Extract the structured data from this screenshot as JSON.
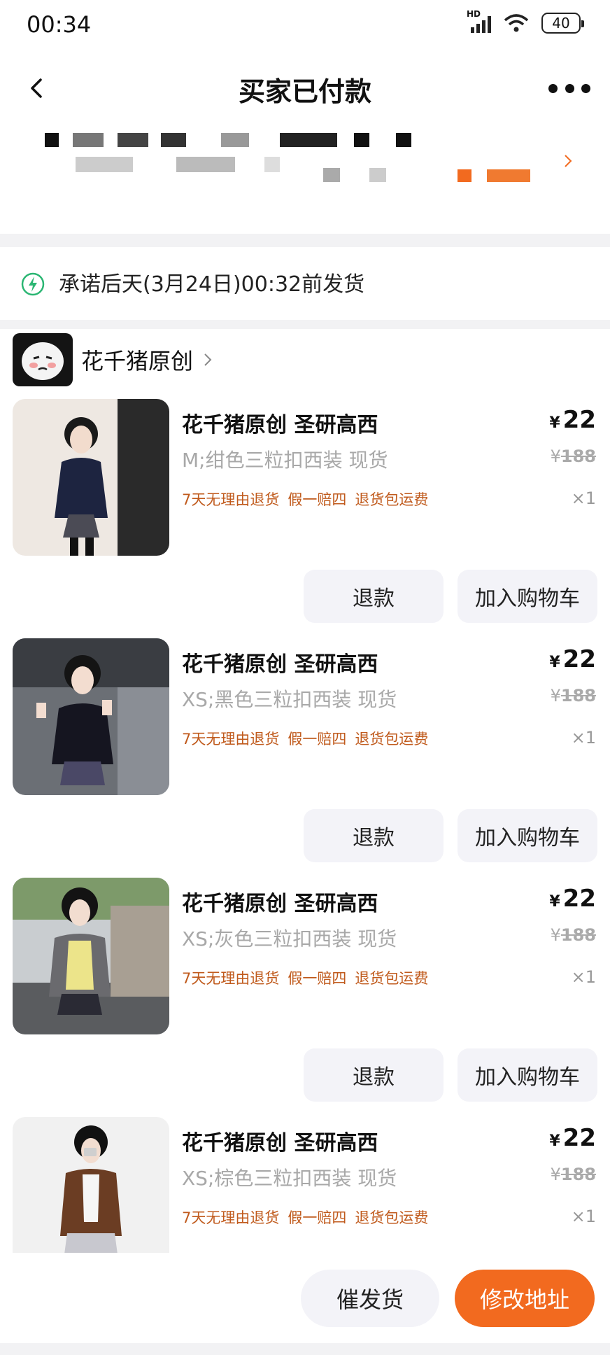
{
  "status_bar": {
    "time": "00:34",
    "network": "HD",
    "battery": "40"
  },
  "nav": {
    "title": "买家已付款"
  },
  "promise": {
    "text": "承诺后天(3月24日)00:32前发货"
  },
  "shop": {
    "name": "花千猪原创"
  },
  "items": [
    {
      "title": "花千猪原创 圣研高西",
      "sku": "M;绀色三粒扣西装 现货",
      "price_symbol": "¥",
      "price": "22",
      "original_price": "188",
      "quantity": "×1",
      "tags": [
        "7天无理由退货",
        "假一赔四",
        "退货包运费"
      ],
      "refund_label": "退款",
      "cart_label": "加入购物车"
    },
    {
      "title": "花千猪原创 圣研高西",
      "sku": "XS;黑色三粒扣西装 现货",
      "price_symbol": "¥",
      "price": "22",
      "original_price": "188",
      "quantity": "×1",
      "tags": [
        "7天无理由退货",
        "假一赔四",
        "退货包运费"
      ],
      "refund_label": "退款",
      "cart_label": "加入购物车"
    },
    {
      "title": "花千猪原创 圣研高西",
      "sku": "XS;灰色三粒扣西装 现货",
      "price_symbol": "¥",
      "price": "22",
      "original_price": "188",
      "quantity": "×1",
      "tags": [
        "7天无理由退货",
        "假一赔四",
        "退货包运费"
      ],
      "refund_label": "退款",
      "cart_label": "加入购物车"
    },
    {
      "title": "花千猪原创 圣研高西",
      "sku": "XS;棕色三粒扣西装 现货",
      "price_symbol": "¥",
      "price": "22",
      "original_price": "188",
      "quantity": "×1",
      "tags": [
        "7天无理由退货",
        "假一赔四",
        "退货包运费"
      ]
    }
  ],
  "bottom_bar": {
    "urge_label": "催发货",
    "modify_address_label": "修改地址"
  },
  "colors": {
    "accent": "#f26a1f",
    "promise_icon": "#2bb673",
    "tag_text": "#c05a1c"
  },
  "icons": {
    "back": "chevron-left-icon",
    "more": "more-dots-icon",
    "promise": "lightning-circle-icon",
    "shop_chevron": "chevron-right-icon"
  }
}
